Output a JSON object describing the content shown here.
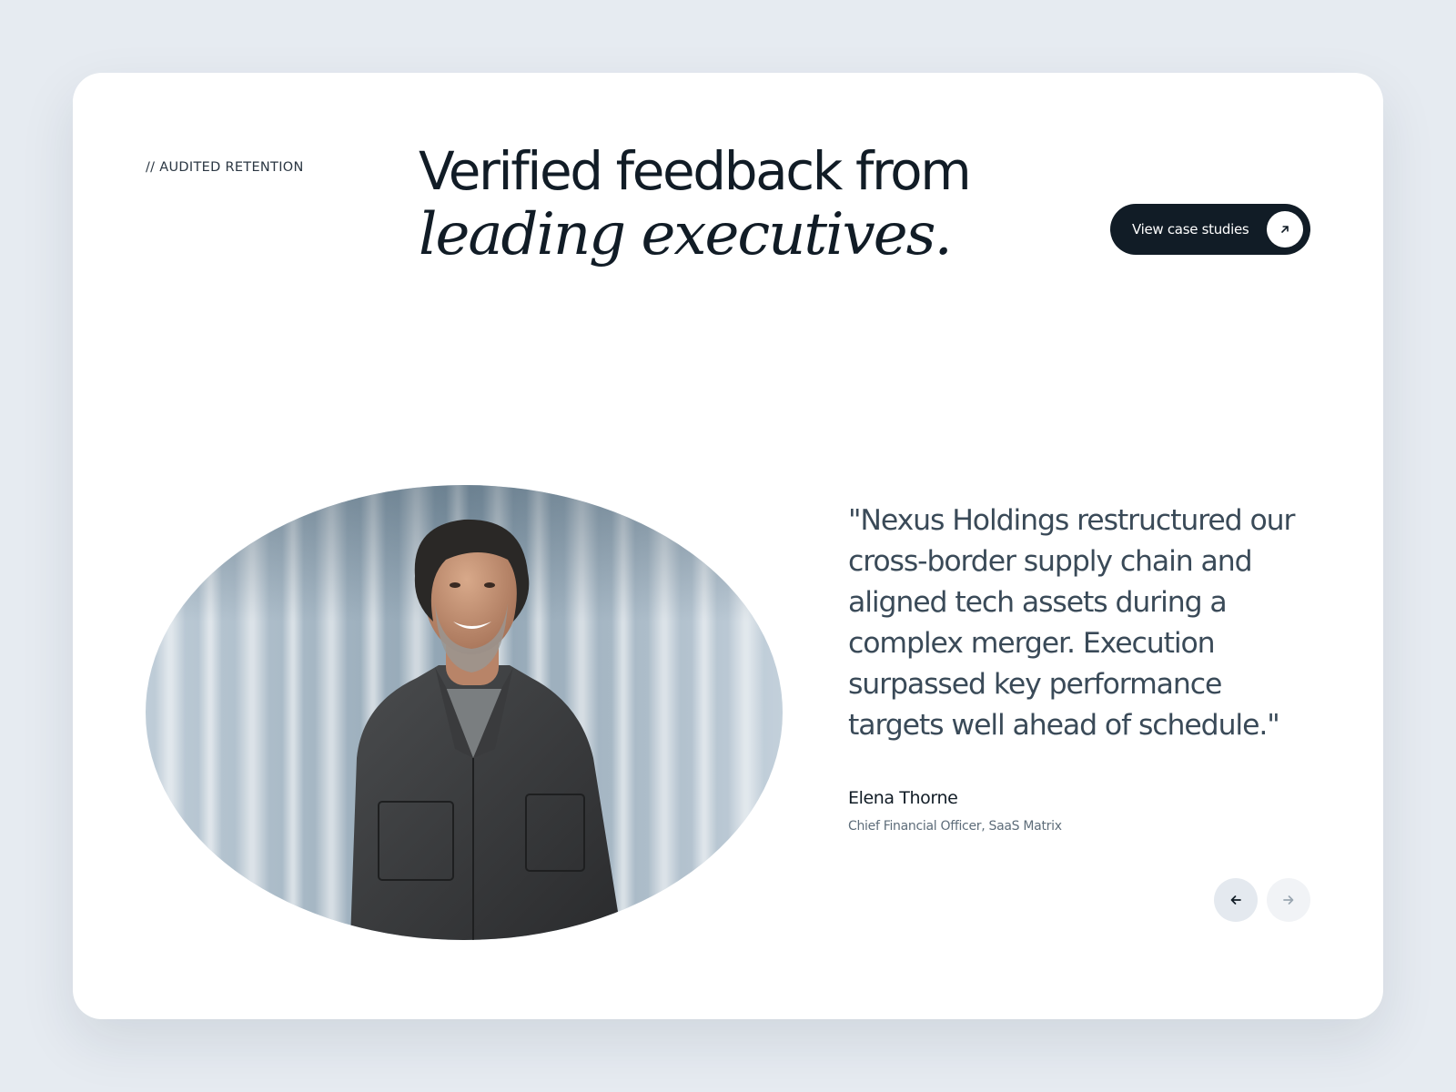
{
  "section": {
    "eyebrow": "// AUDITED RETENTION",
    "headline_line1": "Verified feedback from",
    "headline_line2": "leading executives."
  },
  "cta": {
    "label": "View case studies",
    "icon": "arrow-up-right-icon"
  },
  "testimonial": {
    "quote": "\"Nexus Holdings restructured our cross-border supply chain and aligned tech assets during a complex merger. Execution surpassed key performance targets well ahead of schedule.\"",
    "author_name": "Elena Thorne",
    "author_role": "Chief Financial Officer, SaaS Matrix"
  },
  "navigation": {
    "prev_icon": "arrow-left-icon",
    "next_icon": "arrow-right-icon",
    "next_enabled": false
  },
  "colors": {
    "page_background": "#e6ebf1",
    "card_background": "#ffffff",
    "primary_dark": "#111c26",
    "quote_text": "#3a4a58",
    "muted_text": "#5e6d7a"
  }
}
